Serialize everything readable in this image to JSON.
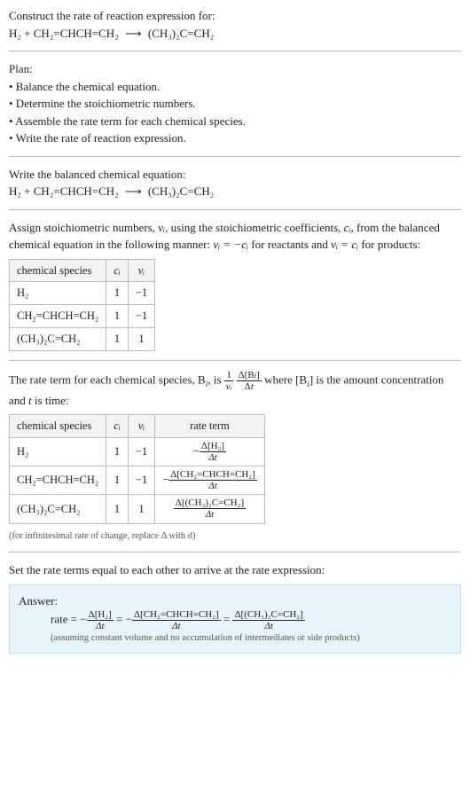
{
  "prompt": "Construct the rate of reaction expression for:",
  "reaction": {
    "lhs": [
      "H₂",
      "CH₂=CHCH=CH₂"
    ],
    "rhs": [
      "(CH₃)₂C=CH₂"
    ]
  },
  "plan": {
    "title": "Plan:",
    "items": [
      "• Balance the chemical equation.",
      "• Determine the stoichiometric numbers.",
      "• Assemble the rate term for each chemical species.",
      "• Write the rate of reaction expression."
    ]
  },
  "balanced": {
    "title": "Write the balanced chemical equation:",
    "lhs": [
      "H₂",
      "CH₂=CHCH=CH₂"
    ],
    "rhs": [
      "(CH₃)₂C=CH₂"
    ]
  },
  "stoich": {
    "intro_a": "Assign stoichiometric numbers, ",
    "intro_b": ", using the stoichiometric coefficients, ",
    "intro_c": ", from the balanced chemical equation in the following manner: ",
    "intro_d": " for reactants and ",
    "intro_e": " for products:",
    "nu": "νᵢ",
    "ci": "cᵢ",
    "rel_react": "νᵢ = −cᵢ",
    "rel_prod": "νᵢ = cᵢ",
    "headers": [
      "chemical species",
      "cᵢ",
      "νᵢ"
    ],
    "rows": [
      {
        "species": "H₂",
        "c": "1",
        "v": "−1"
      },
      {
        "species": "CH₂=CHCH=CH₂",
        "c": "1",
        "v": "−1"
      },
      {
        "species": "(CH₃)₂C=CH₂",
        "c": "1",
        "v": "1"
      }
    ]
  },
  "rateterm": {
    "intro_a": "The rate term for each chemical species, B",
    "intro_b": ", is ",
    "intro_c": " where [B",
    "intro_d": "] is the amount concentration and ",
    "intro_e": " is time:",
    "t": "t",
    "headers": [
      "chemical species",
      "cᵢ",
      "νᵢ",
      "rate term"
    ],
    "rows": [
      {
        "species": "H₂",
        "c": "1",
        "v": "−1",
        "neg": "−",
        "num": "Δ[H₂]",
        "den": "Δt"
      },
      {
        "species": "CH₂=CHCH=CH₂",
        "c": "1",
        "v": "−1",
        "neg": "−",
        "num": "Δ[CH₂=CHCH=CH₂]",
        "den": "Δt"
      },
      {
        "species": "(CH₃)₂C=CH₂",
        "c": "1",
        "v": "1",
        "neg": "",
        "num": "Δ[(CH₃)₂C=CH₂]",
        "den": "Δt"
      }
    ],
    "note": "(for infinitesimal rate of change, replace Δ with d)"
  },
  "final": {
    "intro": "Set the rate terms equal to each other to arrive at the rate expression:",
    "answer_label": "Answer:",
    "rate_label": "rate = ",
    "eq": " = ",
    "terms": [
      {
        "neg": "−",
        "num": "Δ[H₂]",
        "den": "Δt"
      },
      {
        "neg": "−",
        "num": "Δ[CH₂=CHCH=CH₂]",
        "den": "Δt"
      },
      {
        "neg": "",
        "num": "Δ[(CH₃)₂C=CH₂]",
        "den": "Δt"
      }
    ],
    "note": "(assuming constant volume and no accumulation of intermediates or side products)"
  },
  "chart_data": {
    "type": "table",
    "tables": [
      {
        "title": "stoichiometric numbers",
        "columns": [
          "chemical species",
          "c_i",
          "nu_i"
        ],
        "rows": [
          [
            "H2",
            1,
            -1
          ],
          [
            "CH2=CHCH=CH2",
            1,
            -1
          ],
          [
            "(CH3)2C=CH2",
            1,
            1
          ]
        ]
      },
      {
        "title": "rate terms",
        "columns": [
          "chemical species",
          "c_i",
          "nu_i",
          "rate term"
        ],
        "rows": [
          [
            "H2",
            1,
            -1,
            "-Δ[H2]/Δt"
          ],
          [
            "CH2=CHCH=CH2",
            1,
            -1,
            "-Δ[CH2=CHCH=CH2]/Δt"
          ],
          [
            "(CH3)2C=CH2",
            1,
            1,
            "Δ[(CH3)2C=CH2]/Δt"
          ]
        ]
      }
    ]
  }
}
